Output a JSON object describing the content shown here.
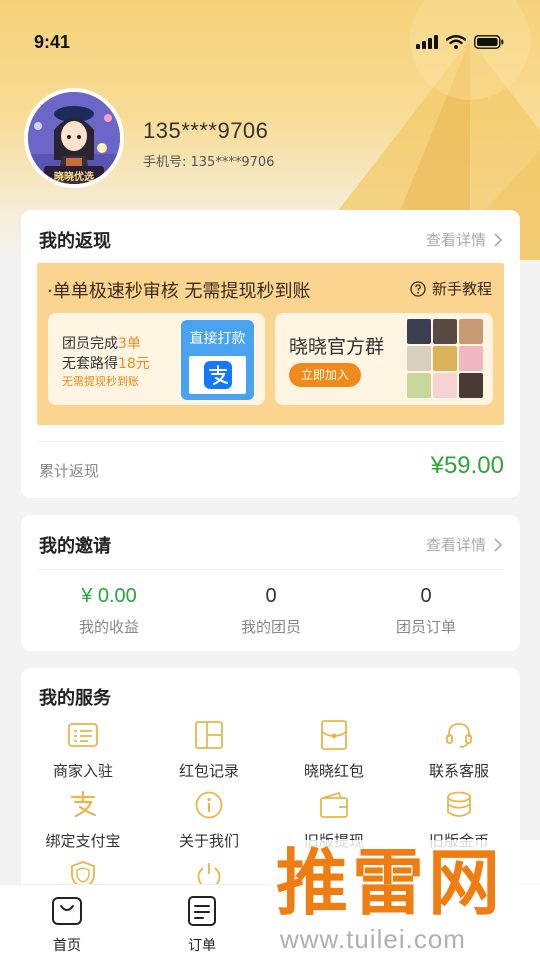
{
  "status": {
    "time": "9:41"
  },
  "profile": {
    "name": "135****9706",
    "phone": "手机号: 135****9706",
    "avatar_caption": "晓晓优选"
  },
  "cashback": {
    "title": "我的返现",
    "more": "查看详情",
    "banner_headline": "·单单极速秒审核 无需提现秒到账",
    "tutorial": "新手教程",
    "promo_line1_prefix": "团员完成",
    "promo_line1_highlight": "3单",
    "promo_line2_prefix": "无套路得",
    "promo_line2_highlight": "18元",
    "promo_line3": "无需提现秒到账",
    "pay_label": "直接打款",
    "group_name": "晓晓官方群",
    "join_label": "立即加入",
    "total_label": "累计返现",
    "total_value": "¥59.00"
  },
  "invite": {
    "title": "我的邀请",
    "more": "查看详情",
    "stats": [
      {
        "value": "¥ 0.00",
        "label": "我的收益"
      },
      {
        "value": "0",
        "label": "我的团员"
      },
      {
        "value": "0",
        "label": "团员订单"
      }
    ]
  },
  "services": {
    "title": "我的服务",
    "items": [
      {
        "label": "商家入驻",
        "icon": "store-card-icon"
      },
      {
        "label": "红包记录",
        "icon": "grid-record-icon"
      },
      {
        "label": "晓晓红包",
        "icon": "red-envelope-icon"
      },
      {
        "label": "联系客服",
        "icon": "headset-icon"
      },
      {
        "label": "绑定支付宝",
        "icon": "alipay-icon"
      },
      {
        "label": "关于我们",
        "icon": "info-icon"
      },
      {
        "label": "旧版提现",
        "icon": "wallet-icon"
      },
      {
        "label": "旧版金币",
        "icon": "coins-icon"
      }
    ]
  },
  "tabbar": [
    {
      "label": "首页",
      "icon": "shopping-bag-icon"
    },
    {
      "label": "订单",
      "icon": "order-list-icon"
    }
  ],
  "watermark": {
    "main": "推雷网",
    "url": "www.tuilei.com"
  },
  "colors": {
    "accent": "#f08a1c",
    "gold": "#f5d27a",
    "green": "#2ea43a",
    "icon": "#e8b64c"
  }
}
